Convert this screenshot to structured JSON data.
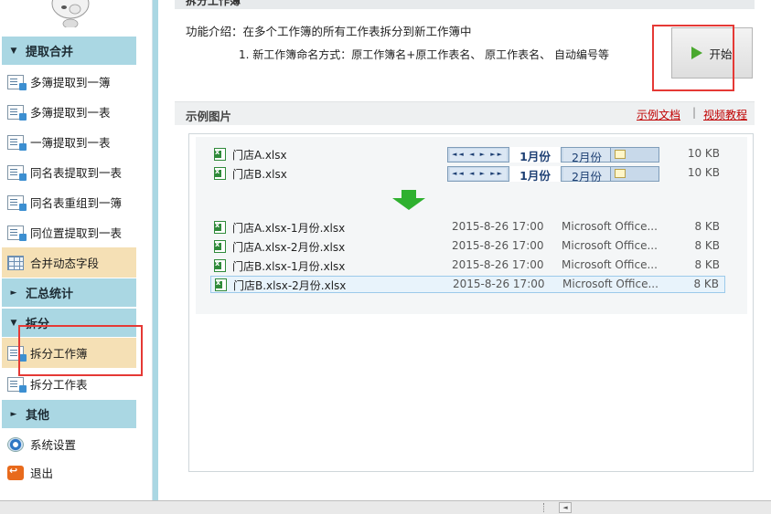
{
  "sidebar": {
    "sections": [
      {
        "label": "提取合并",
        "expanded": true
      },
      {
        "label": "汇总统计",
        "expanded": false
      },
      {
        "label": "拆分",
        "expanded": true
      },
      {
        "label": "其他",
        "expanded": false
      }
    ],
    "items": [
      {
        "label": "多簿提取到一簿",
        "icon": "workbooks-to-workbook-icon"
      },
      {
        "label": "多簿提取到一表",
        "icon": "workbooks-to-sheet-icon"
      },
      {
        "label": "一簿提取到一表",
        "icon": "workbook-to-sheet-icon"
      },
      {
        "label": "同名表提取到一表",
        "icon": "same-name-sheet-icon"
      },
      {
        "label": "同名表重组到一簿",
        "icon": "regroup-sheets-icon"
      },
      {
        "label": "同位置提取到一表",
        "icon": "same-position-icon"
      },
      {
        "label": "合并动态字段",
        "icon": "grid-icon"
      },
      {
        "label": "拆分工作簿",
        "icon": "split-workbook-icon"
      },
      {
        "label": "拆分工作表",
        "icon": "split-sheet-icon"
      },
      {
        "label": "系统设置",
        "icon": "settings-gear-icon"
      },
      {
        "label": "退出",
        "icon": "exit-icon"
      }
    ]
  },
  "main": {
    "page_title": "拆分工作簿",
    "intro": "功能介绍：在多个工作簿的所有工作表拆分到新工作簿中",
    "naming_rule": "1. 新工作簿命名方式：原工作簿名+原工作表名、 原工作表名、 自动编号等",
    "start_button_label": "开始",
    "example_title": "示例图片",
    "example_doc_link": "示例文档",
    "link_separator": "|",
    "video_link": "视频教程"
  },
  "example": {
    "source_files": [
      {
        "name": "门店A.xlsx",
        "size": "10 KB",
        "tab1": "1月份",
        "tab2": "2月份"
      },
      {
        "name": "门店B.xlsx",
        "size": "10 KB",
        "tab1": "1月份",
        "tab2": "2月份"
      }
    ],
    "nav_buttons": "◄◄ ◄ ► ►►",
    "output_files": [
      {
        "name": "门店A.xlsx-1月份.xlsx",
        "date": "2015-8-26 17:00",
        "type": "Microsoft Office...",
        "size": "8 KB"
      },
      {
        "name": "门店A.xlsx-2月份.xlsx",
        "date": "2015-8-26 17:00",
        "type": "Microsoft Office...",
        "size": "8 KB"
      },
      {
        "name": "门店B.xlsx-1月份.xlsx",
        "date": "2015-8-26 17:00",
        "type": "Microsoft Office...",
        "size": "8 KB"
      },
      {
        "name": "门店B.xlsx-2月份.xlsx",
        "date": "2015-8-26 17:00",
        "type": "Microsoft Office...",
        "size": "8 KB",
        "selected": true
      }
    ]
  },
  "colors": {
    "section_header": "#aad7e3",
    "highlight_item": "#f5e0b5",
    "annotation_red": "#e53935",
    "link_red": "#c00000",
    "arrow_green": "#2fb12f",
    "play_green": "#4aa82e"
  }
}
